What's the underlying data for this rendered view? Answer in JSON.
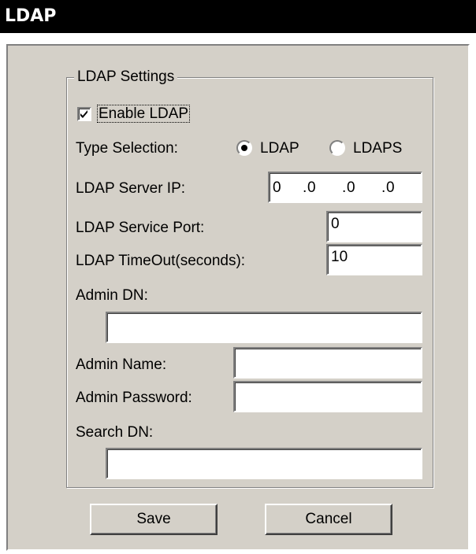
{
  "window": {
    "title": "LDAP"
  },
  "group": {
    "legend": "LDAP Settings"
  },
  "enable": {
    "label": "Enable LDAP",
    "checked": true
  },
  "type_selection": {
    "label": "Type Selection:",
    "options": [
      {
        "label": "LDAP",
        "selected": true
      },
      {
        "label": "LDAPS",
        "selected": false
      }
    ]
  },
  "server_ip": {
    "label": "LDAP Server IP:",
    "octets": [
      "0",
      "0",
      "0",
      "0"
    ],
    "separator": "."
  },
  "service_port": {
    "label": "LDAP Service Port:",
    "value": "0"
  },
  "timeout": {
    "label": "LDAP TimeOut(seconds):",
    "value": "10"
  },
  "admin_dn": {
    "label": "Admin DN:",
    "value": ""
  },
  "admin_name": {
    "label": "Admin Name:",
    "value": ""
  },
  "admin_password": {
    "label": "Admin Password:",
    "value": ""
  },
  "search_dn": {
    "label": "Search DN:",
    "value": ""
  },
  "buttons": {
    "save": "Save",
    "cancel": "Cancel"
  },
  "colors": {
    "face": "#d4d0c8",
    "title_bar": "#000000",
    "title_text": "#ffffff"
  }
}
